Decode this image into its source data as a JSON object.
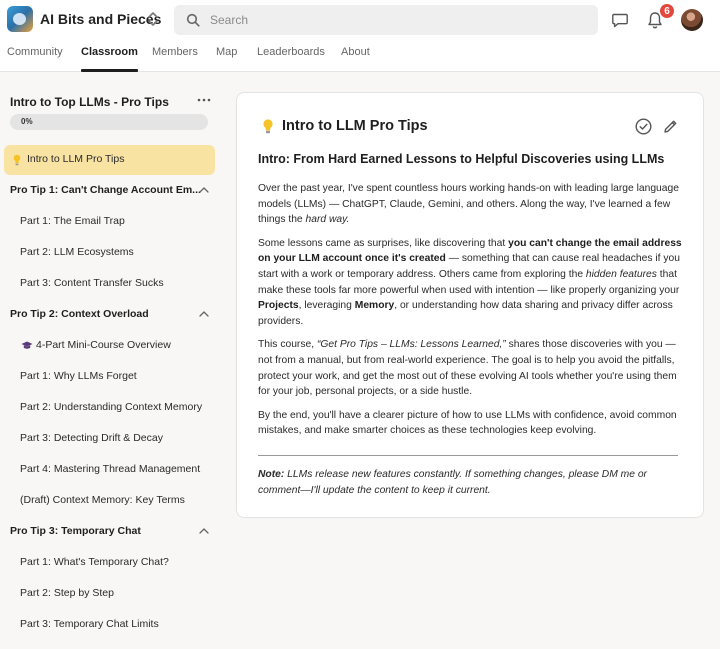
{
  "header": {
    "app_name": "AI Bits and Pieces",
    "search_placeholder": "Search",
    "notification_count": "6",
    "icons": [
      "logo",
      "switcher-icon",
      "search-icon",
      "chat-icon",
      "bell-icon",
      "avatar"
    ]
  },
  "tabs": [
    "Community",
    "Classroom",
    "Members",
    "Map",
    "Leaderboards",
    "About"
  ],
  "active_tab": "Classroom",
  "sidebar": {
    "course_title": "Intro to Top LLMs - Pro Tips",
    "progress_text": "0%",
    "progress_value": 0,
    "items": [
      {
        "label": "Intro to LLM Pro Tips",
        "type": "lesson",
        "icon": "lightbulb-icon",
        "active": true
      },
      {
        "label": "Pro Tip 1: Can't Change Account Em...",
        "type": "section"
      },
      {
        "label": "Part 1: The Email Trap",
        "type": "lesson"
      },
      {
        "label": "Part 2: LLM Ecosystems",
        "type": "lesson"
      },
      {
        "label": "Part 3: Content Transfer Sucks",
        "type": "lesson"
      },
      {
        "label": "Pro Tip 2: Context Overload",
        "type": "section"
      },
      {
        "label": "4-Part Mini-Course Overview",
        "type": "lesson",
        "icon": "graduation-cap-icon"
      },
      {
        "label": "Part 1: Why LLMs Forget",
        "type": "lesson"
      },
      {
        "label": "Part 2: Understanding Context Memory",
        "type": "lesson"
      },
      {
        "label": "Part 3: Detecting Drift & Decay",
        "type": "lesson"
      },
      {
        "label": "Part 4: Mastering Thread Management",
        "type": "lesson"
      },
      {
        "label": "(Draft) Context Memory: Key Terms",
        "type": "lesson"
      },
      {
        "label": "Pro Tip 3: Temporary Chat",
        "type": "section"
      },
      {
        "label": "Part 1: What's Temporary Chat?",
        "type": "lesson"
      },
      {
        "label": "Part 2: Step by Step",
        "type": "lesson"
      },
      {
        "label": "Part 3: Temporary Chat Limits",
        "type": "lesson"
      }
    ]
  },
  "lesson": {
    "title": "Intro to LLM Pro Tips",
    "heading": "Intro: From Hard Earned Lessons to Helpful Discoveries using LLMs",
    "p1_a": "Over the past year, I've spent countless hours working hands-on with leading large language models (LLMs) — ChatGPT, Claude, Gemini, and others. Along the way, I've learned a few things the ",
    "p1_em": "hard way.",
    "p2_a": "Some lessons came as surprises, like discovering that ",
    "p2_b": "you can't change the email address on your LLM account once it's created",
    "p2_c": " — something that can cause real headaches if you start with a work or temporary address. Others came from exploring the ",
    "p2_d": "hidden features",
    "p2_e": " that make these tools far more powerful when used with intention — like properly organizing your ",
    "p2_f": "Projects",
    "p2_g": ", leveraging ",
    "p2_h": "Memory",
    "p2_i": ", or understanding how data sharing and privacy differ across providers.",
    "p3_a": "This course, ",
    "p3_em": "“Get Pro Tips – LLMs: Lessons Learned,”",
    "p3_b": " shares those discoveries with you — not from a manual, but from real-world experience. The goal is to help you avoid the pitfalls, protect your work, and get the most out of these evolving AI tools whether you're using them for your job, personal projects, or a side hustle.",
    "p4": "By the end, you'll have a clearer picture of how to use LLMs with confidence, avoid common mistakes, and make smarter choices as these technologies keep evolving.",
    "note_label": "Note:",
    "note_text": " LLMs release new features constantly. If something changes, please DM me or comment—I'll update the content to keep it current.",
    "icons": [
      "lightbulb-icon",
      "check-circle-icon",
      "pencil-icon"
    ]
  },
  "colors": {
    "accent_active": "#f8e3a3",
    "badge": "#e2483d",
    "page_bg": "#f8f7f5"
  }
}
